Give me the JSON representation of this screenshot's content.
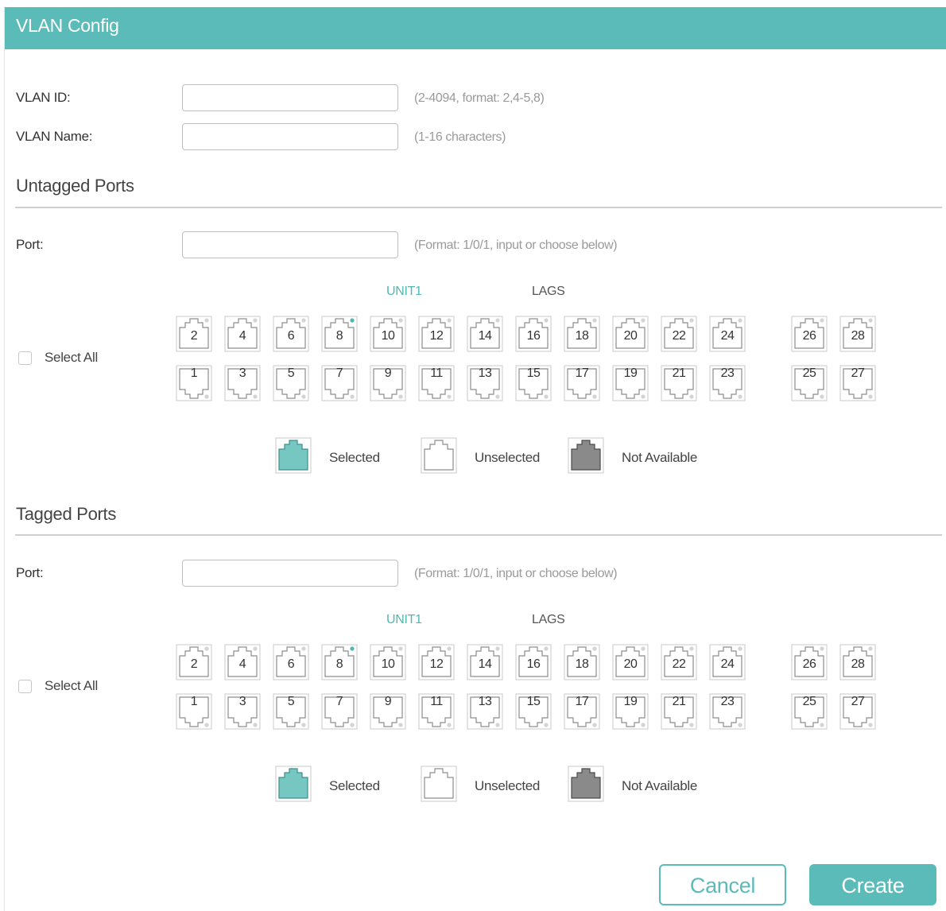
{
  "dialog": {
    "title": "VLAN Config"
  },
  "colors": {
    "accent": "#5bbbb9",
    "selected": "#76c6c2",
    "not_available": "#8a8a8a",
    "dot": "#4fb8b4"
  },
  "form": {
    "vlan_id_label": "VLAN ID:",
    "vlan_id_value": "",
    "vlan_id_hint": "(2-4094, format: 2,4-5,8)",
    "vlan_name_label": "VLAN Name:",
    "vlan_name_value": "",
    "vlan_name_hint": "(1-16 characters)"
  },
  "untagged": {
    "title": "Untagged Ports",
    "port_label": "Port:",
    "port_value": "",
    "port_hint": "(Format: 1/0/1, input or choose below)",
    "unit_label": "UNIT1",
    "lags_label": "LAGS",
    "select_all": "Select All",
    "legend": {
      "selected": "Selected",
      "unselected": "Unselected",
      "not_available": "Not Available"
    }
  },
  "tagged": {
    "title": "Tagged Ports",
    "port_label": "Port:",
    "port_value": "",
    "port_hint": "(Format: 1/0/1, input or choose below)",
    "unit_label": "UNIT1",
    "lags_label": "LAGS",
    "select_all": "Select All",
    "legend": {
      "selected": "Selected",
      "unselected": "Unselected",
      "not_available": "Not Available"
    }
  },
  "ports": {
    "top_row": [
      "2",
      "4",
      "6",
      "8",
      "10",
      "12",
      "14",
      "16",
      "18",
      "20",
      "22",
      "24",
      "26",
      "28"
    ],
    "bottom_row": [
      "1",
      "3",
      "5",
      "7",
      "9",
      "11",
      "13",
      "15",
      "17",
      "19",
      "21",
      "23",
      "25",
      "27"
    ],
    "link_up": [
      "8"
    ]
  },
  "buttons": {
    "cancel": "Cancel",
    "create": "Create"
  }
}
